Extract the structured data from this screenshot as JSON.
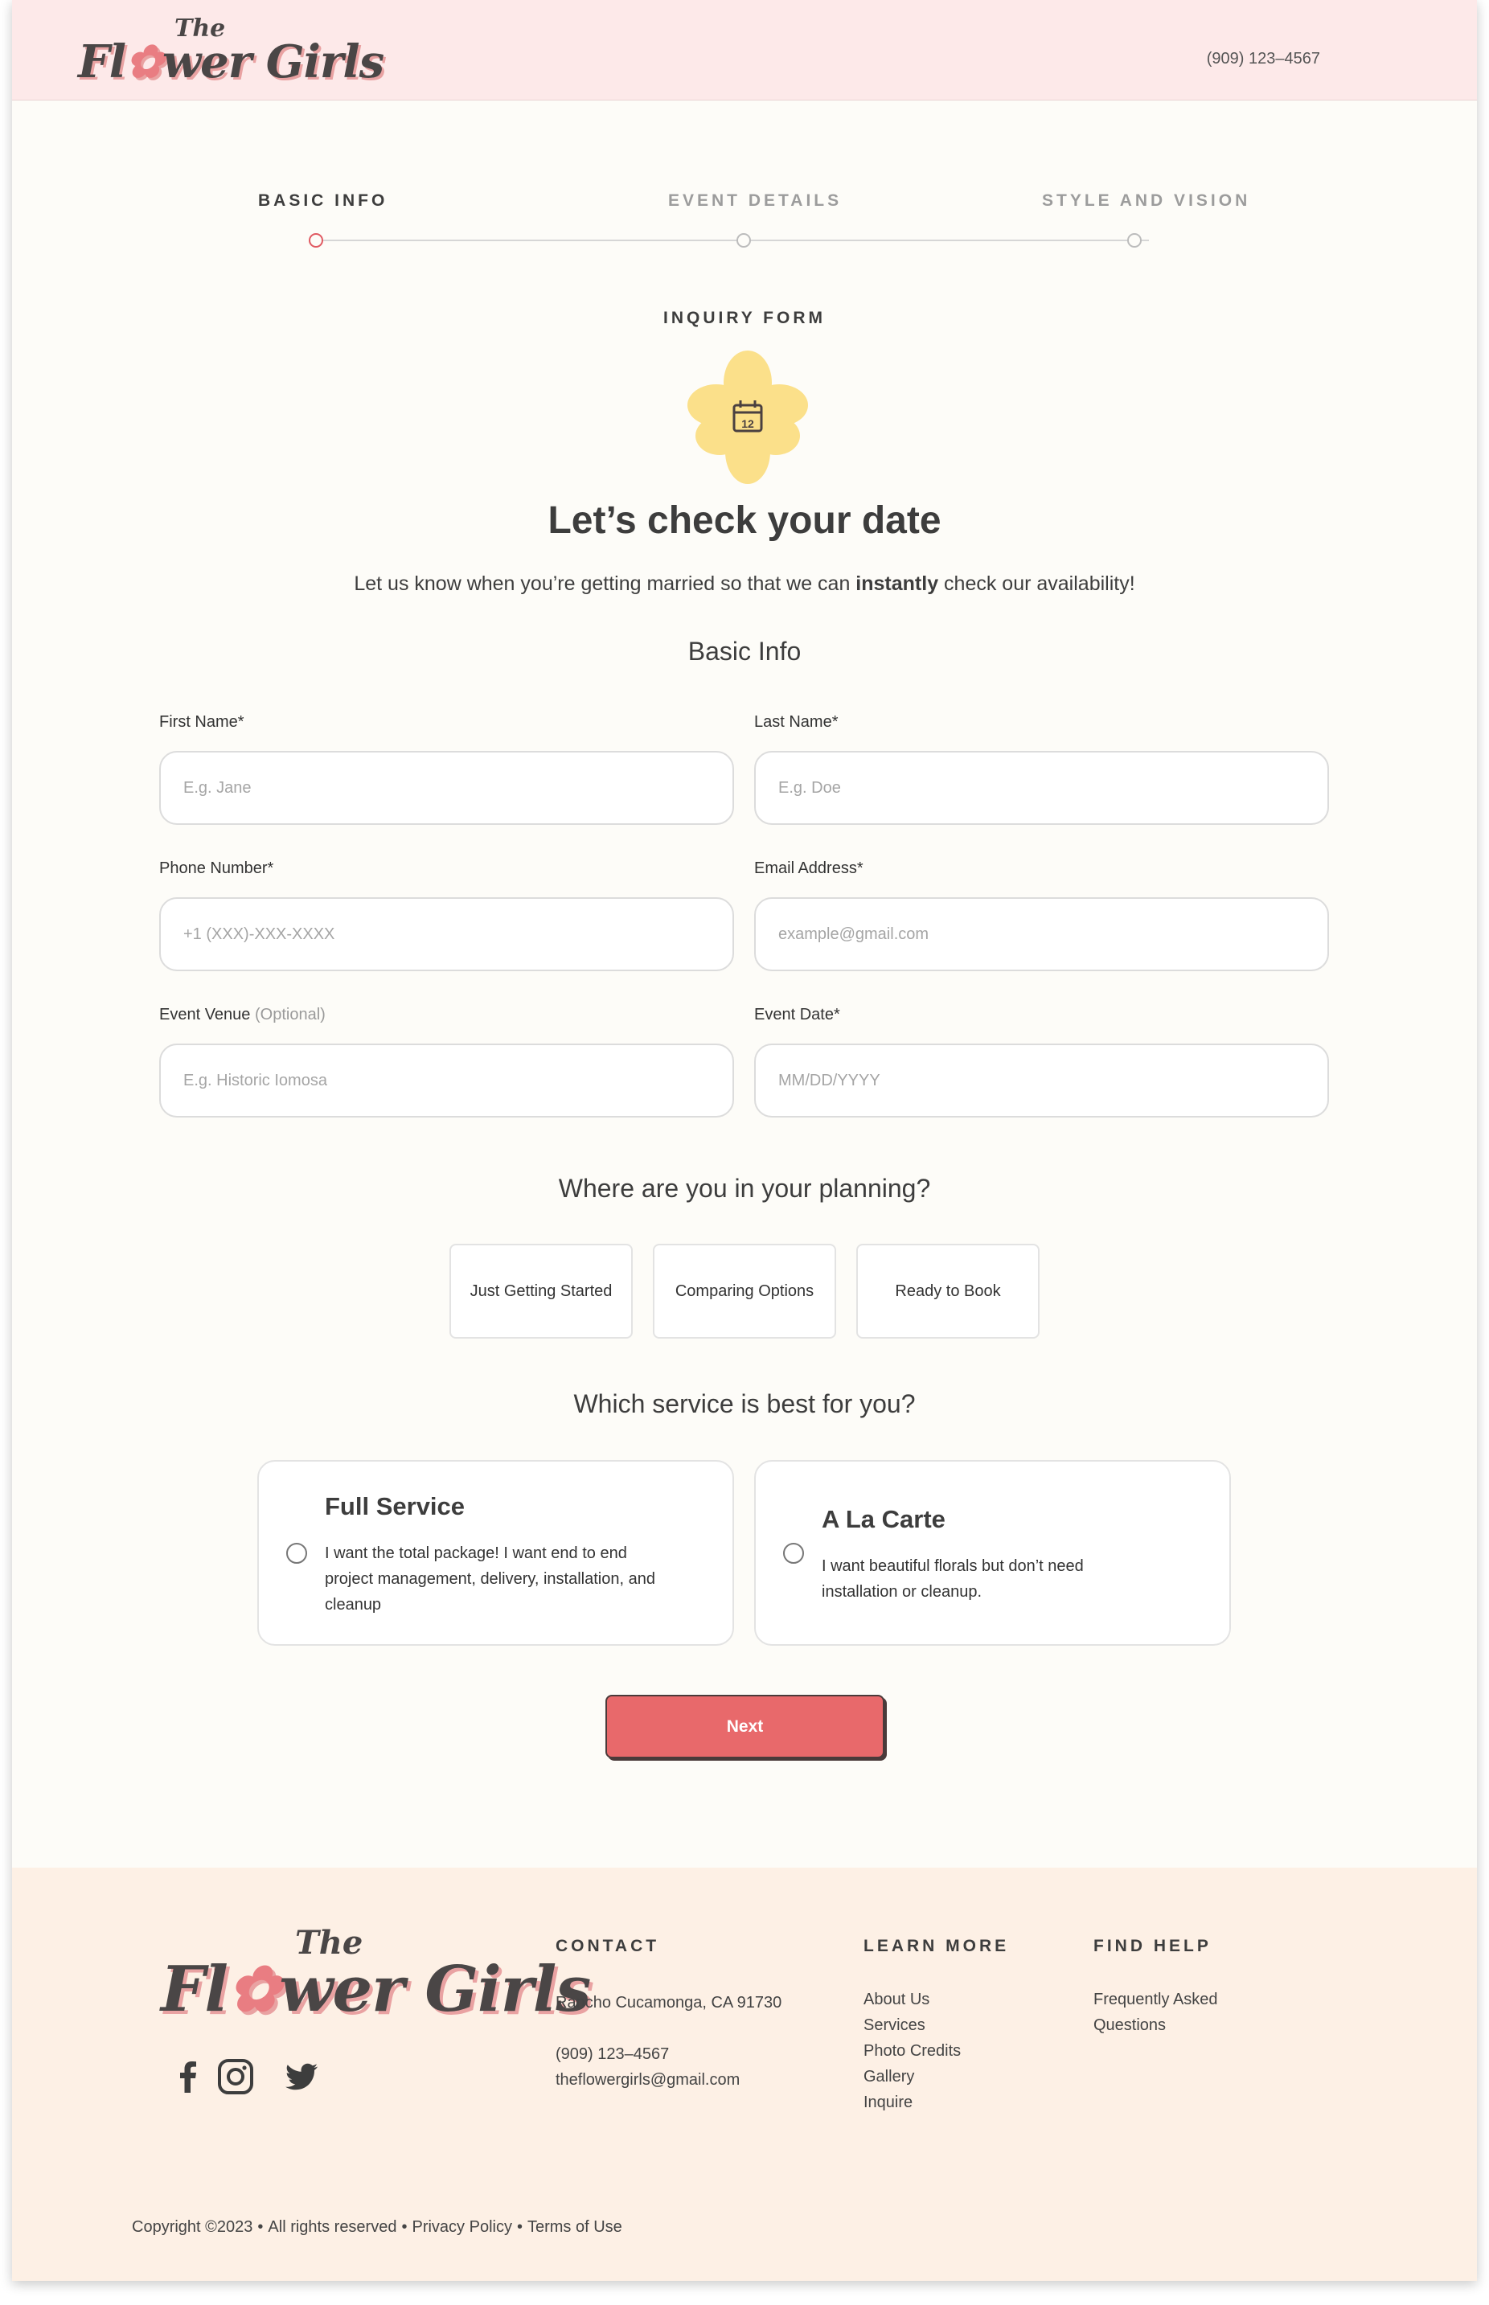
{
  "brand": {
    "logo_the": "The",
    "logo_part1": "Fl",
    "logo_flower": "✿",
    "logo_part2": "wer Girls"
  },
  "header": {
    "phone": "(909) 123–4567"
  },
  "stepper": {
    "steps": [
      {
        "label": "BASIC INFO",
        "active": true
      },
      {
        "label": "EVENT DETAILS",
        "active": false
      },
      {
        "label": "STYLE AND VISION",
        "active": false
      }
    ]
  },
  "intro": {
    "kicker": "INQUIRY FORM",
    "calendar_icon_day": "12",
    "headline": "Let’s check your date",
    "sub_before": "Let us know when you’re getting married so that we can ",
    "sub_bold": "instantly",
    "sub_after": " check our availability!"
  },
  "basic_info": {
    "heading": "Basic Info",
    "first_name": {
      "label": "First Name*",
      "placeholder": "E.g. Jane",
      "value": ""
    },
    "last_name": {
      "label": "Last Name*",
      "placeholder": "E.g. Doe",
      "value": ""
    },
    "phone": {
      "label": "Phone Number*",
      "placeholder": "+1 (XXX)-XXX-XXXX",
      "value": ""
    },
    "email": {
      "label": "Email Address*",
      "placeholder": "example@gmail.com",
      "value": ""
    },
    "venue": {
      "label": "Event Venue ",
      "label_optional": "(Optional)",
      "placeholder": "E.g. Historic Iomosa",
      "value": ""
    },
    "event_date": {
      "label": "Event Date*",
      "placeholder": "MM/DD/YYYY",
      "value": ""
    }
  },
  "planning": {
    "heading": "Where are you in your planning?",
    "options": [
      "Just Getting Started",
      "Comparing Options",
      "Ready to Book"
    ]
  },
  "service": {
    "heading": "Which service is best for you?",
    "options": [
      {
        "title": "Full Service",
        "description": "I want the total package! I want end to end project management, delivery, installation, and cleanup",
        "selected": false
      },
      {
        "title": "A La Carte",
        "description": "I want beautiful florals but don’t need installation or cleanup.",
        "selected": false
      }
    ]
  },
  "next_label": "Next",
  "footer": {
    "contact": {
      "heading": "CONTACT",
      "address": "Rancho Cucamonga, CA 91730",
      "phone": "(909) 123–4567",
      "email": "theflowergirls@gmail.com"
    },
    "learn_more": {
      "heading": "LEARN MORE",
      "links": [
        "About Us",
        "Services",
        "Photo Credits",
        "Gallery",
        "Inquire"
      ]
    },
    "find_help": {
      "heading": "FIND HELP",
      "links": [
        "Frequently Asked",
        "Questions"
      ]
    },
    "social": [
      "facebook-icon",
      "instagram-icon",
      "twitter-icon"
    ],
    "copyright": "Copyright ©2023",
    "rights": "All rights reserved",
    "privacy": "Privacy Policy",
    "terms": "Terms of Use",
    "bullet": "•"
  },
  "colors": {
    "header_bg": "#fde9e9",
    "page_bg": "#fdfcf8",
    "footer_bg": "#fdf0e5",
    "accent_red": "#e8696b",
    "flower_yellow": "#fbe08a",
    "text_dark": "#3d3d3d"
  }
}
